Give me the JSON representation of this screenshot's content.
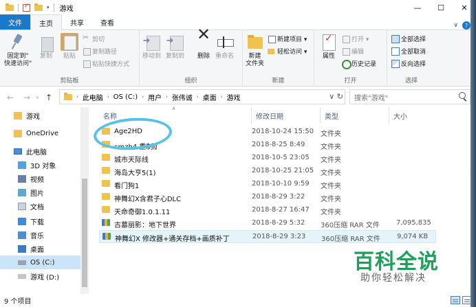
{
  "window": {
    "title": "游戏",
    "controls": [
      "—",
      "☐",
      "✕"
    ]
  },
  "ribbon_tabs": [
    "文件",
    "主页",
    "共享",
    "查看"
  ],
  "ribbon": {
    "clipboard": {
      "pin": "固定到\"\n快速访问\"",
      "copy": "复制",
      "paste": "粘贴",
      "cut": "剪切",
      "copy_path": "复制路径",
      "paste_shortcut": "粘贴快捷方式",
      "label": "剪贴板"
    },
    "organize": {
      "move_to": "移动到",
      "copy_to": "复制到",
      "delete": "删除",
      "rename": "重命名",
      "label": "组织"
    },
    "new": {
      "new_folder": "新建\n文件夹",
      "new_item": "新建项目 ▾",
      "easy_access": "轻松访问 ▾",
      "label": "新建"
    },
    "open": {
      "properties": "属性",
      "open": "打开 ▾",
      "edit": "编辑",
      "history": "历史记录",
      "label": "打开"
    },
    "select": {
      "select_all": "全部选择",
      "select_none": "全部取消",
      "invert": "反向选择",
      "label": "选择"
    }
  },
  "address": {
    "crumbs": [
      "此电脑",
      "OS (C:)",
      "用户",
      "张伟诚",
      "桌面",
      "游戏"
    ],
    "search_placeholder": "搜索\"游戏\""
  },
  "nav": [
    {
      "label": "游戏",
      "icon": "folder"
    },
    {
      "label": "OneDrive",
      "icon": "cloud"
    },
    {
      "label": "此电脑",
      "icon": "pc"
    },
    {
      "label": "3D 对象",
      "icon": "cube"
    },
    {
      "label": "视频",
      "icon": "film"
    },
    {
      "label": "图片",
      "icon": "pic"
    },
    {
      "label": "文档",
      "icon": "docf"
    },
    {
      "label": "下载",
      "icon": "dl"
    },
    {
      "label": "音乐",
      "icon": "music"
    },
    {
      "label": "桌面",
      "icon": "desk"
    },
    {
      "label": "OS (C:)",
      "icon": "drive"
    },
    {
      "label": "游戏 (D:)",
      "icon": "drive2"
    }
  ],
  "columns": [
    "名称",
    "修改日期",
    "类型",
    "大小"
  ],
  "files": [
    {
      "name": "Age2HD",
      "date": "2018-10-24 15:50",
      "type": "文件夹",
      "size": "",
      "icon": "folder"
    },
    {
      "name": "cmzh4 重制版",
      "date": "2018-8-25 8:49",
      "type": "文件夹",
      "size": "",
      "icon": "folder"
    },
    {
      "name": "城市天际线",
      "date": "2018-10-5 23:05",
      "type": "文件夹",
      "size": "",
      "icon": "folder"
    },
    {
      "name": "海岛大亨5(1)",
      "date": "2018-10-25 21:05",
      "type": "文件夹",
      "size": "",
      "icon": "folder"
    },
    {
      "name": "看门狗1",
      "date": "2018-10-10 9:59",
      "type": "文件夹",
      "size": "",
      "icon": "folder"
    },
    {
      "name": "神舞幻X含君子心DLC",
      "date": "2018-8-29 3:22",
      "type": "文件夹",
      "size": "",
      "icon": "folder"
    },
    {
      "name": "天命奇御1.0.1.11",
      "date": "2018-8-27 16:47",
      "type": "文件夹",
      "size": "",
      "icon": "folder"
    },
    {
      "name": "古墓丽影：地下世界",
      "date": "2018-8-29 5:32",
      "type": "360压缩 RAR 文件",
      "size": "7,095,835",
      "icon": "rar"
    },
    {
      "name": "神舞幻X 修改器+通关存档+画质补丁",
      "date": "2018-8-29 3:23",
      "type": "360压缩 RAR 文件",
      "size": "9,074 KB",
      "icon": "rar"
    }
  ],
  "status": {
    "count": "9 个项目"
  },
  "watermark": {
    "title": "百科全说",
    "subtitle": "助你轻松解决"
  },
  "colors": {
    "accent": "#1979ca",
    "selection": "#cce4f7",
    "watermark": "#1aa15a"
  }
}
